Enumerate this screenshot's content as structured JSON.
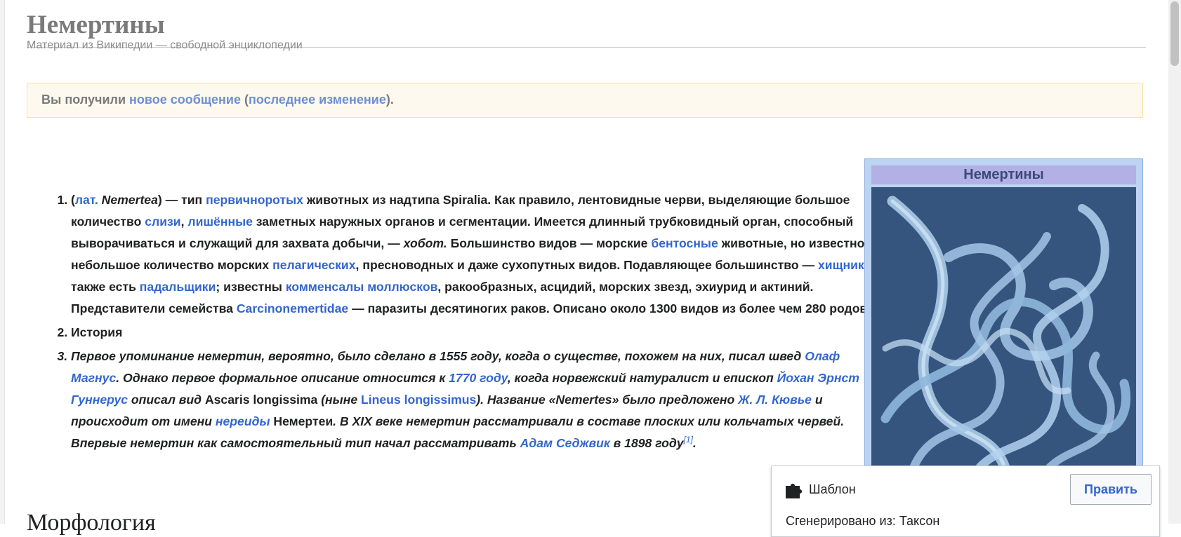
{
  "page": {
    "title": "Немертины",
    "subtitle": "Материал из Википедии — свободной энциклопедии"
  },
  "notice": {
    "prefix": "Вы получили ",
    "link1": "новое сообщение",
    "paren_open": " (",
    "link2": "последнее изменение",
    "suffix": ")."
  },
  "item1": {
    "p0": "(",
    "lat": "лат.",
    "sp": " ",
    "latname": "Nemertea",
    "p1": ") — тип ",
    "l1": "первичноротых",
    "p2": " животных из надтипа Spiralia. Как правило, лентовидные черви, выделяющие большое количество ",
    "l2": "слизи",
    "p3": ", ",
    "l3": "лишённые",
    "p4": " заметных наружных органов и сегментации. Имеется длинный трубковидный орган, способный выворачиваться и служащий для захвата добычи, — ",
    "hobot": "хобот.",
    "p5": " Большинство видов — морские ",
    "l4": "бентосные",
    "p6": " животные, но известно небольшое количество морских ",
    "l5": "пелагических",
    "p7": ", пресноводных и даже сухопутных видов. Подавляющее большинство — ",
    "l6": "хищники",
    "p8": ", также есть ",
    "l7": "падальщики",
    "p9": "; известны ",
    "l8": "комменсалы",
    "p10": " ",
    "l9": "моллюсков",
    "p11": ", ракообразных, асцидий, морских звезд, эхиурид и актиний. Представители семейства ",
    "l10": "Carcinonemertidae",
    "p12": " — паразиты десятиногих раков. Описано около 1300 видов из более чем 280 родов."
  },
  "item2": {
    "text": "История"
  },
  "item3": {
    "p1": "Первое упоминание немертин, вероятно, было сделано в 1555 году, когда о существе, похожем на них, писал швед ",
    "l1": "Олаф Магнус",
    "p2": ". Однако первое формальное описание относится к ",
    "l2": "1770 году",
    "p3": ", когда норвежский натуралист и епископ ",
    "l3": "Йохан Эрнст Гуннерус",
    "p4": " описал вид ",
    "ascaris": "Ascaris longissima",
    "p5": " (ныне ",
    "l4": "Lineus longissimus",
    "p6": "). Название «Nemertes» было предложено ",
    "l5": "Ж. Л. Кювье",
    "p7": " и происходит от имени ",
    "l6": "нереиды",
    "p8": " ",
    "nemertei": "Немертеи",
    "p9": ". В XIX веке немертин рассматривали в составе плоских или кольчатых червей. Впервые немертин как самостоятельный тип начал рассматривать ",
    "l7": "Адам Седжвик",
    "p10": " в 1898 году",
    "ref": "[1]",
    "p11": "."
  },
  "infobox": {
    "title": "Немертины"
  },
  "popup": {
    "label": "Шаблон",
    "button": "Править",
    "sub": "Сгенерировано из: Таксон"
  },
  "next_heading": "Морфология",
  "colors": {
    "link": "#3366cc",
    "notice_bg": "#fef9ef",
    "infobox_bg": "#bcd3f2",
    "infobox_title_bg": "#b3b0e6",
    "image_bg": "#3a5a82"
  },
  "icons": [
    "puzzle-icon"
  ]
}
